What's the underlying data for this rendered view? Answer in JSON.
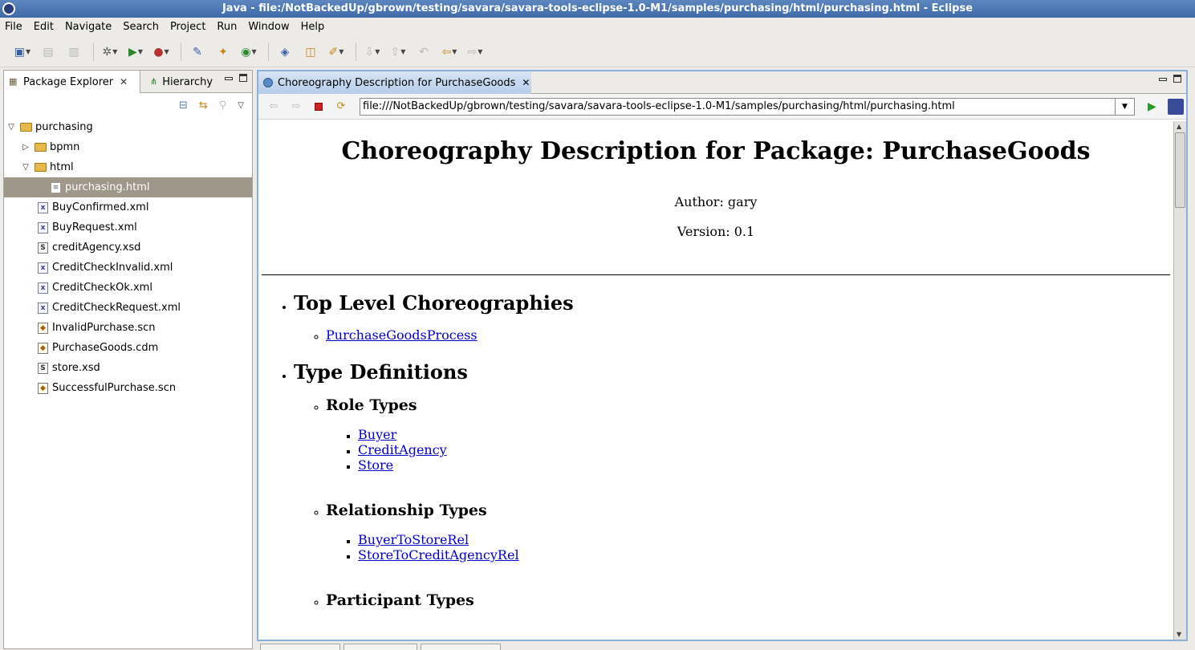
{
  "window": {
    "title": "Java - file:/NotBackedUp/gbrown/testing/savara/savara-tools-eclipse-1.0-M1/samples/purchasing/html/purchasing.html - Eclipse"
  },
  "menu": [
    "File",
    "Edit",
    "Navigate",
    "Search",
    "Project",
    "Run",
    "Window",
    "Help"
  ],
  "left_panel": {
    "tabs": [
      {
        "label": "Package Explorer",
        "active": true
      },
      {
        "label": "Hierarchy",
        "active": false
      }
    ],
    "tree": [
      {
        "label": "purchasing",
        "level": 0,
        "type": "project",
        "expanded": true
      },
      {
        "label": "bpmn",
        "level": 1,
        "type": "folder",
        "expanded": false
      },
      {
        "label": "html",
        "level": 1,
        "type": "folder",
        "expanded": true
      },
      {
        "label": "purchasing.html",
        "level": 2,
        "type": "html",
        "selected": true
      },
      {
        "label": "BuyConfirmed.xml",
        "level": 1,
        "type": "xml"
      },
      {
        "label": "BuyRequest.xml",
        "level": 1,
        "type": "xml"
      },
      {
        "label": "creditAgency.xsd",
        "level": 1,
        "type": "xsd"
      },
      {
        "label": "CreditCheckInvalid.xml",
        "level": 1,
        "type": "xml"
      },
      {
        "label": "CreditCheckOk.xml",
        "level": 1,
        "type": "xml"
      },
      {
        "label": "CreditCheckRequest.xml",
        "level": 1,
        "type": "xml"
      },
      {
        "label": "InvalidPurchase.scn",
        "level": 1,
        "type": "scn"
      },
      {
        "label": "PurchaseGoods.cdm",
        "level": 1,
        "type": "scn"
      },
      {
        "label": "store.xsd",
        "level": 1,
        "type": "xsd"
      },
      {
        "label": "SuccessfulPurchase.scn",
        "level": 1,
        "type": "scn"
      }
    ]
  },
  "editor": {
    "tab_label": "Choreography Description for PurchaseGoods",
    "url": "file:///NotBackedUp/gbrown/testing/savara/savara-tools-eclipse-1.0-M1/samples/purchasing/html/purchasing.html"
  },
  "document": {
    "title": "Choreography Description for Package: PurchaseGoods",
    "author": "Author: gary",
    "version": "Version: 0.1",
    "sections": {
      "top_level": {
        "heading": "Top Level Choreographies",
        "links": [
          "PurchaseGoodsProcess"
        ]
      },
      "type_definitions": {
        "heading": "Type Definitions",
        "role_types": {
          "heading": "Role Types",
          "links": [
            "Buyer",
            "CreditAgency",
            "Store"
          ]
        },
        "relationship_types": {
          "heading": "Relationship Types",
          "links": [
            "BuyerToStoreRel",
            "StoreToCreditAgencyRel"
          ]
        },
        "participant_types": {
          "heading": "Participant Types"
        }
      }
    }
  }
}
